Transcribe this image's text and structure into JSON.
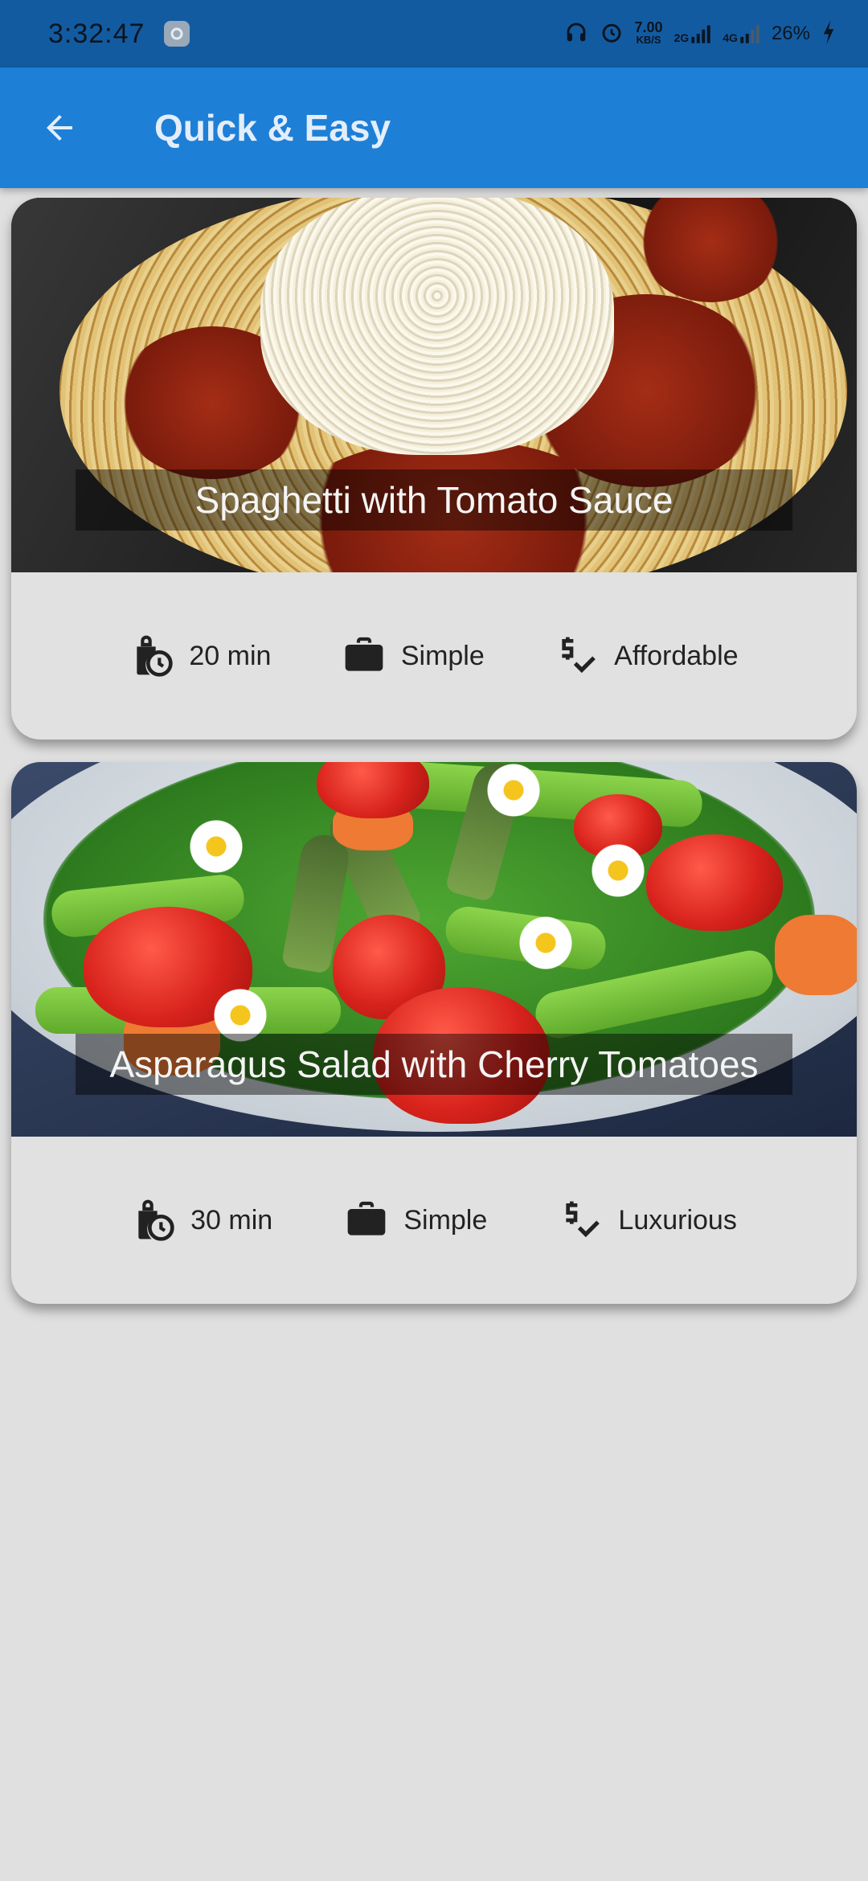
{
  "status_bar": {
    "time": "3:32:47",
    "speed_value": "7.00",
    "speed_unit": "KB/S",
    "network_2g": "2G",
    "network_4g": "4G",
    "battery": "26%"
  },
  "app_bar": {
    "title": "Quick & Easy",
    "back_icon": "arrow-back-icon"
  },
  "meals": [
    {
      "title": "Spaghetti with Tomato Sauce",
      "duration": "20 min",
      "complexity": "Simple",
      "affordability": "Affordable"
    },
    {
      "title": "Asparagus Salad with Cherry Tomatoes",
      "duration": "30 min",
      "complexity": "Simple",
      "affordability": "Luxurious"
    }
  ],
  "icons": {
    "duration": "schedule-icon",
    "complexity": "work-icon",
    "affordability": "price-check-icon"
  },
  "colors": {
    "status_bar": "#135ba1",
    "app_bar": "#1e7fd6",
    "background": "#e0e0e0",
    "card": "#e1e1e1"
  }
}
